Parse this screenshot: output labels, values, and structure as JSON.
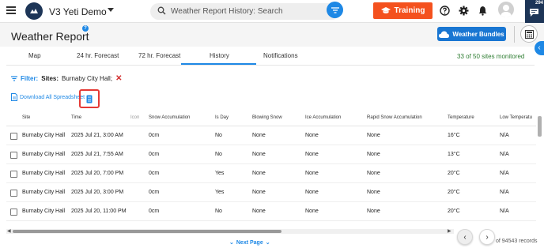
{
  "topbar": {
    "app_title": "V3 Yeti Demo",
    "search_placeholder": "Weather Report History: Search",
    "training_label": "Training",
    "chat_badge": "294",
    "icons": [
      "menu-icon",
      "logo-icon",
      "search-icon",
      "filter-icon",
      "graduation-cap-icon",
      "help-icon",
      "gear-icon",
      "bell-icon",
      "avatar",
      "chat-icon"
    ]
  },
  "header": {
    "title": "Weather Report",
    "help_mark": "?",
    "bundles_label": "Weather Bundles"
  },
  "tabs": [
    {
      "label": "Map",
      "active": false
    },
    {
      "label": "24 hr. Forecast",
      "active": false
    },
    {
      "label": "72 hr. Forecast",
      "active": false
    },
    {
      "label": "History",
      "active": true
    },
    {
      "label": "Notifications",
      "active": false
    }
  ],
  "sites_monitored": "33 of 50 sites monitored",
  "filter": {
    "label": "Filter:",
    "sites_label": "Sites:",
    "sites_value": "Burnaby City Hall;",
    "remove": "✕"
  },
  "download_label": "Download All Spreadsheet",
  "table": {
    "columns": [
      "Site",
      "Time",
      "Icon",
      "Snow Accumulation",
      "Is Day",
      "Blowing Snow",
      "Ice Accumulation",
      "Rapid Snow Accumulation",
      "Temperature",
      "Low Temperatu"
    ],
    "rows": [
      [
        "Burnaby City Hall",
        "2025 Jul 21, 3:00 AM",
        "",
        "0cm",
        "No",
        "None",
        "None",
        "None",
        "16°C",
        "N/A"
      ],
      [
        "Burnaby City Hall",
        "2025 Jul 21, 7:55 AM",
        "",
        "0cm",
        "No",
        "None",
        "None",
        "None",
        "13°C",
        "N/A"
      ],
      [
        "Burnaby City Hall",
        "2025 Jul 20, 7:00 PM",
        "",
        "0cm",
        "Yes",
        "None",
        "None",
        "None",
        "20°C",
        "N/A"
      ],
      [
        "Burnaby City Hall",
        "2025 Jul 20, 3:00 PM",
        "",
        "0cm",
        "Yes",
        "None",
        "None",
        "None",
        "20°C",
        "N/A"
      ],
      [
        "Burnaby City Hall",
        "2025 Jul 20, 11:00 PM",
        "",
        "0cm",
        "No",
        "None",
        "None",
        "None",
        "20°C",
        "N/A"
      ]
    ]
  },
  "pagination": {
    "next_label": "Next Page",
    "prev_arrow": "‹",
    "next_arrow": "›",
    "record_count": "of 94543 records"
  },
  "colors": {
    "brand_navy": "#1d3557",
    "accent_blue": "#1e88e5",
    "training_orange": "#f4511e",
    "monitored_green": "#2e7d32",
    "remove_red": "#d32f2f"
  }
}
